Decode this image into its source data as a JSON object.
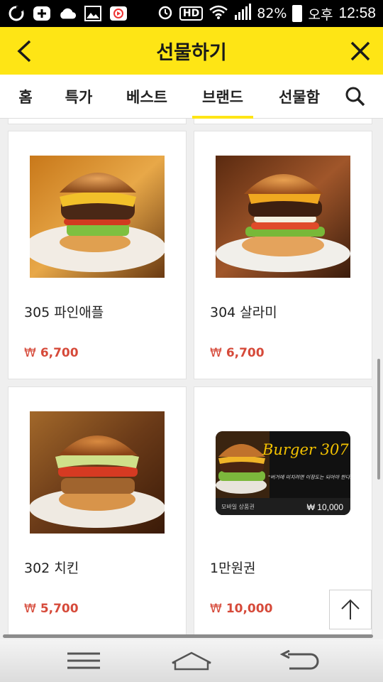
{
  "status_bar": {
    "battery": "82%",
    "ampm": "오후",
    "time": "12:58",
    "hd_label": "HD"
  },
  "app_bar": {
    "title": "선물하기",
    "back_icon": "chevron-left-icon",
    "close_icon": "close-icon",
    "background": "#fee515"
  },
  "tabs": [
    {
      "label": "홈",
      "active": false
    },
    {
      "label": "특가",
      "active": false
    },
    {
      "label": "베스트",
      "active": false
    },
    {
      "label": "브랜드",
      "active": true
    },
    {
      "label": "선물함",
      "active": false
    }
  ],
  "products": [
    {
      "name": "305 파인애플",
      "currency": "₩",
      "price": "6,700",
      "image": "burger-pineapple-photo"
    },
    {
      "name": "304 살라미",
      "currency": "₩",
      "price": "6,700",
      "image": "burger-salami-photo"
    },
    {
      "name": "302 치킨",
      "currency": "₩",
      "price": "5,700",
      "image": "burger-chicken-photo"
    },
    {
      "name": "1만원권",
      "currency": "₩",
      "price": "10,000",
      "image": "gift-card-image"
    }
  ],
  "gift_card": {
    "brand": "Burger 307",
    "tagline": "\"버거에 미치려면 이정도는 되어야 한다!\"",
    "mobile_label": "모바일 상품권",
    "amount": "₩ 10,000"
  },
  "accent_price_color": "#d64a3a"
}
